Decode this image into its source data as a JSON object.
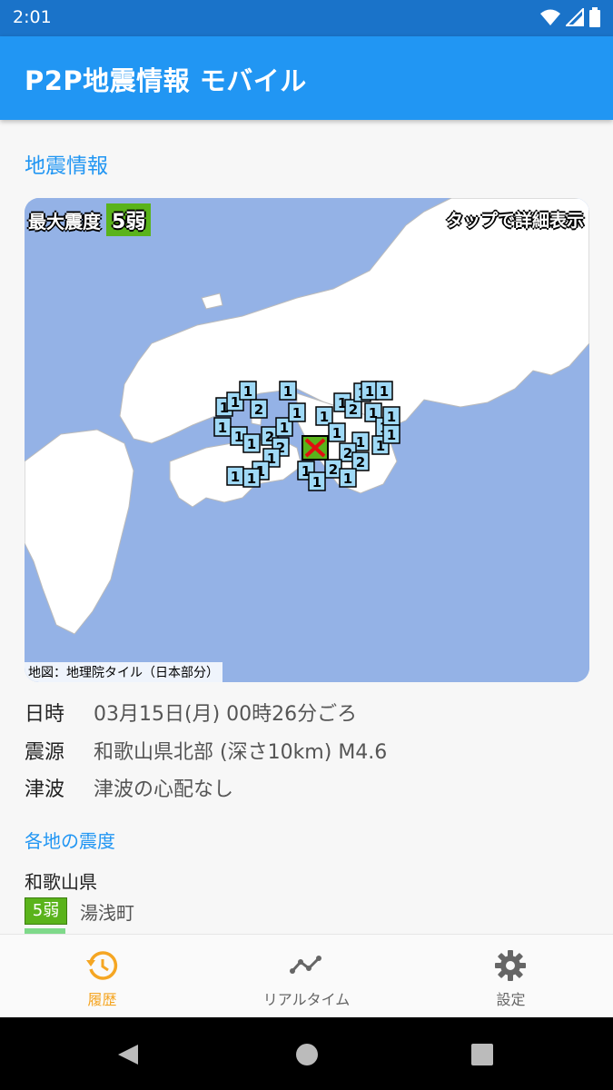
{
  "status": {
    "time": "2:01"
  },
  "app": {
    "title": "P2P地震情報 モバイル"
  },
  "section": {
    "earthquake_info": "地震情報",
    "regional_intensity": "各地の震度"
  },
  "map": {
    "max_label": "最大震度",
    "max_intensity": "5弱",
    "tap_hint": "タップで詳細表示",
    "credit": "地図：地理院タイル（日本部分）"
  },
  "details": {
    "datetime_label": "日時",
    "datetime_value": "03月15日(月) 00時26分ごろ",
    "epicenter_label": "震源",
    "epicenter_value": "和歌山県北部 (深さ10km) M4.6",
    "tsunami_label": "津波",
    "tsunami_value": "津波の心配なし"
  },
  "regions": [
    {
      "prefecture": "和歌山県",
      "intensity": "5弱",
      "city": "湯浅町"
    }
  ],
  "nav": {
    "items": [
      {
        "label": "履歴",
        "icon": "history-icon",
        "active": true
      },
      {
        "label": "リアルタイム",
        "icon": "timeline-icon",
        "active": false
      },
      {
        "label": "設定",
        "icon": "gear-icon",
        "active": false
      }
    ]
  },
  "colors": {
    "accent": "#2196f3",
    "active_nav": "#f5a623",
    "intensity_5lower": "#5ab31b",
    "sea": "#94b2e6",
    "station_marker": "#9fd9f6"
  }
}
